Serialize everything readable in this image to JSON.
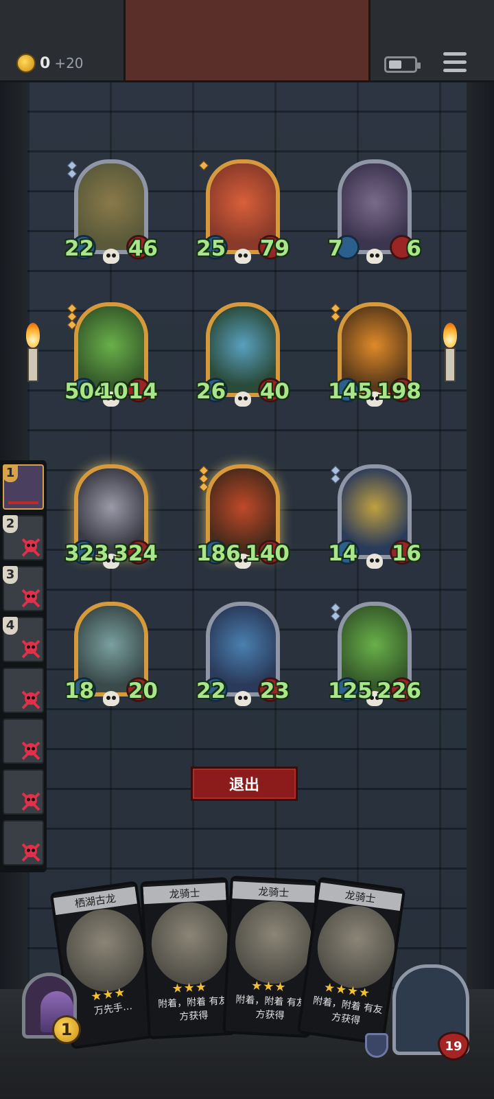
{
  "header": {
    "coin_count": "0",
    "coin_bonus": "+20"
  },
  "units": [
    {
      "name": "scarecrow-witch",
      "attack": "22",
      "health": "46",
      "rarity": "silver",
      "stars": 2
    },
    {
      "name": "tomato-demon",
      "attack": "25",
      "health": "79",
      "rarity": "gold",
      "stars": 1
    },
    {
      "name": "horned-elf",
      "attack": "7",
      "health": "6",
      "rarity": "silver",
      "stars": 0
    },
    {
      "name": "leaf-sprite",
      "attack": "504",
      "health": "1014",
      "rarity": "gold",
      "stars": 3
    },
    {
      "name": "crystal-vine",
      "attack": "26",
      "health": "40",
      "rarity": "gold",
      "stars": 0
    },
    {
      "name": "pumpkin-ghost",
      "attack": "145",
      "health": "198",
      "rarity": "gold",
      "stars": 2
    },
    {
      "name": "horned-dragon",
      "attack": "323",
      "health": "324",
      "rarity": "gold",
      "stars": 0
    },
    {
      "name": "fire-dragon",
      "attack": "186",
      "health": "140",
      "rarity": "gold",
      "stars": 3
    },
    {
      "name": "dragon-knight",
      "attack": "14",
      "health": "16",
      "rarity": "silver",
      "stars": 2
    },
    {
      "name": "bat-dragon",
      "attack": "18",
      "health": "20",
      "rarity": "gold",
      "stars": 0
    },
    {
      "name": "blue-elf",
      "attack": "22",
      "health": "23",
      "rarity": "silver",
      "stars": 0
    },
    {
      "name": "leaf-sprite-2",
      "attack": "125",
      "health": "226",
      "rarity": "silver",
      "stars": 2
    }
  ],
  "queue": [
    {
      "num": "1",
      "active": true
    },
    {
      "num": "2",
      "active": false
    },
    {
      "num": "3",
      "active": false
    },
    {
      "num": "4",
      "active": false
    },
    {
      "num": "",
      "active": false
    },
    {
      "num": "",
      "active": false
    },
    {
      "num": "",
      "active": false
    },
    {
      "num": "",
      "active": false
    }
  ],
  "exit_label": "退出",
  "hand": [
    {
      "title": "栖湖古龙",
      "stars": "★★★",
      "text": "万先手…"
    },
    {
      "title": "龙骑士",
      "stars": "★★★",
      "text": "附着，附着 有友方获得"
    },
    {
      "title": "龙骑士",
      "stars": "★★★",
      "text": "附着，附着 有友方获得"
    },
    {
      "title": "龙骑士",
      "stars": "★★★★",
      "text": "附着，附着 有友方获得"
    }
  ],
  "bottom": {
    "gold_count": "1",
    "hero_hp": "19"
  }
}
